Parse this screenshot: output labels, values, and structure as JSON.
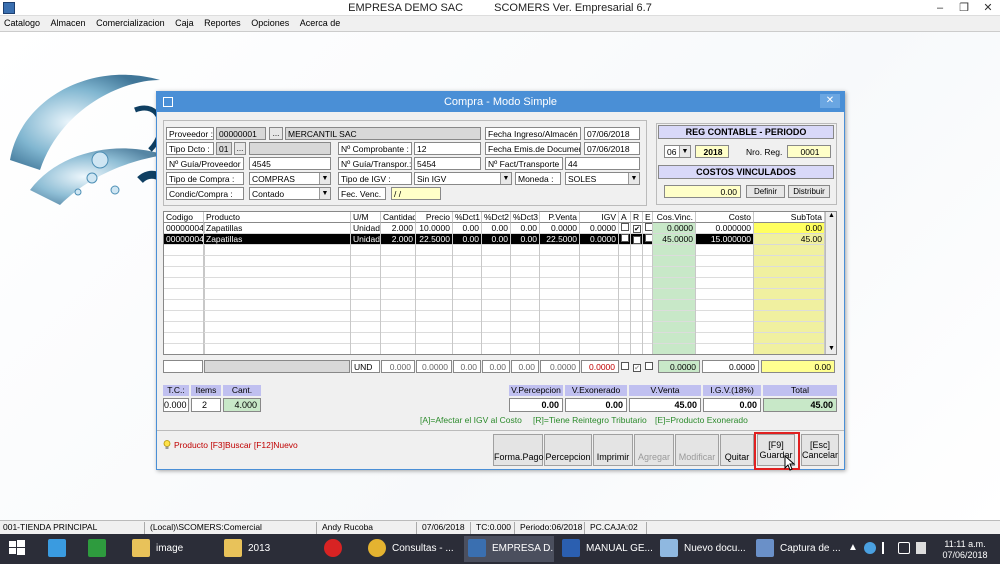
{
  "window": {
    "company": "EMPRESA DEMO SAC",
    "product": "SCOMERS Ver. Empresarial  6.7",
    "minimize": "–",
    "restore": "❐",
    "close": "✕"
  },
  "menu": [
    "Catalogo",
    "Almacen",
    "Comercializacion",
    "Caja",
    "Reportes",
    "Opciones",
    "Acerca de"
  ],
  "dialog": {
    "title": "Compra  - Modo Simple",
    "close_glyph": "✕",
    "header": {
      "proveedor_label": "Proveedor :",
      "proveedor_code": "00000001",
      "ellipsis": "...",
      "proveedor_name": "MERCANTIL SAC",
      "tipo_dcto_label": "Tipo Dcto :",
      "tipo_dcto_value": "01",
      "guia_prov_label": "Nº Guía/Proveedor :",
      "guia_prov_value": "4545",
      "tipo_compra_label": "Tipo de Compra :",
      "tipo_compra_value": "COMPRAS",
      "condic_label": "Condic/Compra :",
      "condic_value": "Contado",
      "comprobante_label": "Nº Comprobante :",
      "comprobante_value": "12",
      "guia_transp_label": "Nº Guía/Transpor.:",
      "guia_transp_value": "5454",
      "tipo_igv_label": "Tipo de IGV :",
      "tipo_igv_value": "Sin IGV",
      "fec_venc_label": "Fec. Venc.",
      "fec_venc_value": "/ /",
      "fecha_ingreso_label": "Fecha Ingreso/Almacén",
      "fecha_ingreso_value": "07/06/2018",
      "fecha_emis_label": "Fecha Emis.de Documento",
      "fecha_emis_value": "07/06/2018",
      "fact_transp_label": "Nº Fact/Transporte :",
      "fact_transp_value": "44",
      "moneda_label": "Moneda :",
      "moneda_value": "SOLES"
    },
    "reg_contable": {
      "title": "REG CONTABLE - PERIODO",
      "month": "06",
      "year": "2018",
      "nro_reg_label": "Nro. Reg.",
      "nro_reg_value": "0001"
    },
    "costos": {
      "title": "COSTOS VINCULADOS",
      "value": "0.00",
      "definir": "Definir",
      "distribuir": "Distribuir"
    },
    "grid": {
      "columns": [
        "Codigo",
        "Producto",
        "U/M",
        "Cantidad",
        "Precio",
        "%Dct1",
        "%Dct2",
        "%Dct3",
        "P.Venta",
        "IGV",
        "A",
        "R",
        "E",
        "Cos.Vinc.",
        "Costo",
        "SubTota"
      ],
      "rows": [
        [
          "00000004",
          "Zapatillas",
          "Unidad",
          "2.000",
          "10.0000",
          "0.00",
          "0.00",
          "0.00",
          "0.0000",
          "0.0000",
          "",
          "✔",
          "",
          "0.0000",
          "0.000000",
          "0.00"
        ],
        [
          "00000004",
          "Zapatillas",
          "Unidad",
          "2.000",
          "22.5000",
          "0.00",
          "0.00",
          "0.00",
          "22.5000",
          "0.0000",
          "",
          "✔",
          "",
          "45.0000",
          "15.000000",
          "45.00"
        ]
      ],
      "scroll_up": "▲",
      "scroll_down": "▼",
      "total_row": {
        "um": "UND",
        "cantidad": "0.000",
        "precio": "0.0000",
        "d1": "0.00",
        "d2": "0.00",
        "d3": "0.00",
        "pventa": "0.0000",
        "igv": "0.0000",
        "cosvinc": "0.0000",
        "costo": "0.0000",
        "subtotal": "0.00"
      }
    },
    "summary": {
      "tc_label": "T.C.:",
      "items_label": "Items",
      "cant_label": "Cant.",
      "tc_value": "0.000",
      "items_value": "2",
      "cant_value": "4.000",
      "percepcion_label": "V.Percepcion",
      "exonerado_label": "V.Exonerado",
      "venta_label": "V.Venta",
      "igv_label": "I.G.V.(18%)",
      "total_label": "Total",
      "percepcion_value": "0.00",
      "exonerado_value": "0.00",
      "venta_value": "45.00",
      "igv_value": "0.00",
      "total_value": "45.00"
    },
    "legend": {
      "a": "[A]=Afectar el IGV al Costo",
      "r": "[R]=Tiene Reintegro Tributario",
      "e": "[E]=Producto Exonerado"
    },
    "hint": "Producto [F3]Buscar [F12]Nuevo",
    "buttons": {
      "forma_pago": "Forma.Pago",
      "percepcion": "Percepcion",
      "imprimir": "Imprimir",
      "agregar": "Agregar",
      "modificar": "Modificar",
      "quitar": "Quitar",
      "guardar_key": "[F9]",
      "guardar": "Guardar",
      "cancelar_key": "[Esc]",
      "cancelar": "Cancelar"
    }
  },
  "statusbar": [
    "001-TIENDA PRINCIPAL",
    "(Local)\\SCOMERS:Comercial",
    "Andy Rucoba",
    "07/06/2018",
    "TC:0.000",
    "Periodo:06/2018",
    "PC.CAJA:02"
  ],
  "taskbar": {
    "items": [
      "image",
      "2013",
      "Consultas - ...",
      "EMPRESA D...",
      "MANUAL GE...",
      "Nuevo docu...",
      "Captura de ..."
    ],
    "time": "11:11 a.m.",
    "date": "07/06/2018"
  },
  "colors": {
    "dialog_title_bg": "#4a8fd6",
    "highlight_box": "#e02020",
    "cosvinc_col": "#c8e8c8",
    "subtotal_col": "#f0f0a0"
  }
}
